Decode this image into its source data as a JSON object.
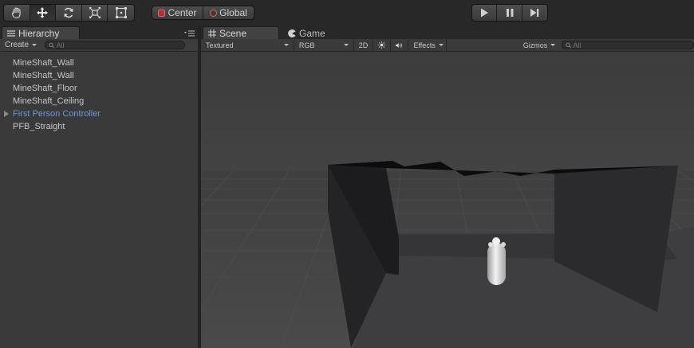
{
  "toolbar": {
    "tools": [
      {
        "name": "hand-tool",
        "icon": "hand-icon",
        "active": false
      },
      {
        "name": "move-tool",
        "icon": "move-arrows-icon",
        "active": true
      },
      {
        "name": "rotate-tool",
        "icon": "rotate-icon",
        "active": false
      },
      {
        "name": "scale-tool",
        "icon": "scale-icon",
        "active": false
      },
      {
        "name": "rect-tool",
        "icon": "rect-transform-icon",
        "active": false
      }
    ],
    "pivot_label": "Center",
    "space_label": "Global",
    "play_icons": [
      "play-icon",
      "pause-icon",
      "step-icon"
    ]
  },
  "hierarchy": {
    "tab_label": "Hierarchy",
    "create_label": "Create",
    "search_placeholder": "All",
    "items": [
      {
        "label": "MineShaft_Wall",
        "prefab": false,
        "foldout": false
      },
      {
        "label": "MineShaft_Wall",
        "prefab": false,
        "foldout": false
      },
      {
        "label": "MineShaft_Floor",
        "prefab": false,
        "foldout": false
      },
      {
        "label": "MineShaft_Ceiling",
        "prefab": false,
        "foldout": false
      },
      {
        "label": "First Person Controller",
        "prefab": true,
        "foldout": true
      },
      {
        "label": "PFB_Straight",
        "prefab": false,
        "foldout": false
      }
    ]
  },
  "scene": {
    "tab_scene": "Scene",
    "tab_game": "Game",
    "draw_mode": "Textured",
    "render_mode": "RGB",
    "mode_2d": "2D",
    "effects_label": "Effects",
    "gizmos_label": "Gizmos",
    "search_placeholder": "All"
  },
  "colors": {
    "prefab_text": "#6f96d8",
    "panel_bg": "#3a3a3a",
    "toolbar_bg": "#282828"
  }
}
